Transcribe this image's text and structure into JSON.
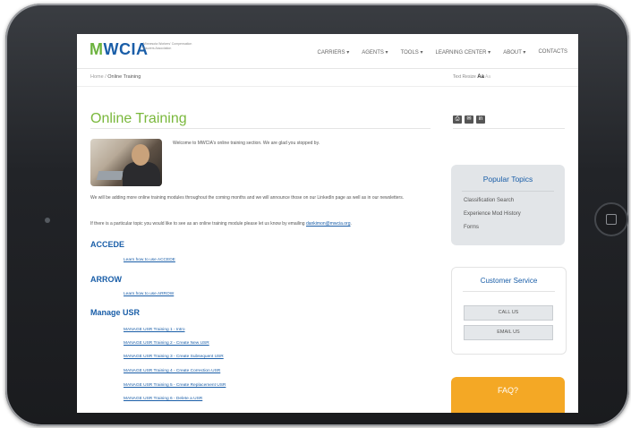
{
  "header": {
    "logo_text": "WCIA",
    "logo_m": "M",
    "logo_sub": "Minnesota Workers' Compensation Insurers Association",
    "nav": [
      "CARRIERS ▾",
      "AGENTS ▾",
      "TOOLS ▾",
      "LEARNING CENTER ▾",
      "ABOUT ▾",
      "CONTACTS"
    ]
  },
  "breadcrumb": {
    "home": "Home",
    "separator": "/",
    "current": "Online Training"
  },
  "text_size": {
    "label": "Text Resize",
    "aa_large": "Aa",
    "aa_small": "Aa"
  },
  "page": {
    "title": "Online Training",
    "welcome": "Welcome to MWCIA's online training section. We are glad you stopped by.",
    "intro1": "We will be adding more online training modules throughout the coming months and we will announce those on our LinkedIn page as well as in our newsletters.",
    "intro2_pre": "If there is a particular topic you would like to see as an online training module please let us know by emailing",
    "intro2_email": "dankimon@mwcia.org",
    "intro2_post": ".",
    "sections": [
      {
        "heading": "ACCEDE",
        "links": [
          "Learn how to use ACCEDE"
        ]
      },
      {
        "heading": "ARROW",
        "links": [
          "Learn how to use ARROW"
        ]
      },
      {
        "heading": "Manage USR",
        "links": [
          "MANAGE USR Training 1 - Intro",
          "MANAGE USR Training 2 - Create New USR",
          "MANAGE USR Training 3 - Create Subsequent USR",
          "MANAGE USR Training 4 - Create Correction USR",
          "MANAGE USR Training 5 - Create Replacement USR",
          "MANAGE USR Training 6 - Delete a USR"
        ]
      }
    ]
  },
  "share_icons": [
    "print-icon",
    "email-icon",
    "linkedin-icon"
  ],
  "share_glyphs": [
    "⎙",
    "✉",
    "in"
  ],
  "popular": {
    "title": "Popular Topics",
    "items": [
      "Classification Search",
      "Experience Mod History",
      "Forms"
    ]
  },
  "customer_service": {
    "title": "Customer Service",
    "call": "CALL US",
    "email": "EMAIL US"
  },
  "faq": {
    "label": "FAQ?"
  },
  "colors": {
    "brand_blue": "#1a5ea8",
    "brand_green": "#7ab83c",
    "faq_orange": "#f4a825"
  }
}
